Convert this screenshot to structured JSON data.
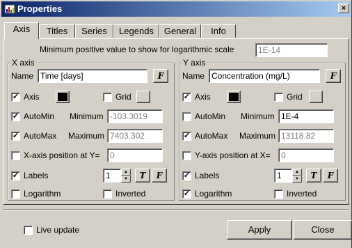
{
  "window": {
    "title": "Properties",
    "close_glyph": "×"
  },
  "tabs": [
    "Axis",
    "Titles",
    "Series",
    "Legends",
    "General",
    "Info"
  ],
  "min_positive": {
    "label": "Minimum positive value to show for  logarithmic scale",
    "value": "1E-14"
  },
  "x_axis": {
    "group_title": "X axis",
    "name_label": "Name",
    "name_value": "Time  [days]",
    "axis_label": "Axis",
    "axis_checked": true,
    "axis_color": "#000000",
    "grid_label": "Grid",
    "grid_checked": false,
    "grid_color": "#d4d0c8",
    "automin_label": "AutoMin",
    "automin_checked": true,
    "minimum_label": "Minimum",
    "minimum_value": "-103.3019",
    "automax_label": "AutoMax",
    "automax_checked": true,
    "maximum_label": "Maximum",
    "maximum_value": "7403.302",
    "pos_label": "X-axis position at Y=",
    "pos_checked": false,
    "pos_value": "0",
    "labels_label": "Labels",
    "labels_checked": true,
    "labels_value": "1",
    "log_label": "Logarithm",
    "log_checked": false,
    "inv_label": "Inverted",
    "inv_checked": false
  },
  "y_axis": {
    "group_title": "Y axis",
    "name_label": "Name",
    "name_value": "Concentration (mg/L)",
    "axis_label": "Axis",
    "axis_checked": true,
    "axis_color": "#000000",
    "grid_label": "Grid",
    "grid_checked": false,
    "grid_color": "#d4d0c8",
    "automin_label": "AutoMin",
    "automin_checked": false,
    "minimum_label": "Minimum",
    "minimum_value": "1E-4",
    "automax_label": "AutoMax",
    "automax_checked": true,
    "maximum_label": "Maximum",
    "maximum_value": "13118.82",
    "pos_label": "Y-axis position at X=",
    "pos_checked": false,
    "pos_value": "0",
    "labels_label": "Labels",
    "labels_checked": true,
    "labels_value": "1",
    "log_label": "Logarithm",
    "log_checked": true,
    "inv_label": "Inverted",
    "inv_checked": false
  },
  "buttons": {
    "f_label": "F",
    "t_label": "T"
  },
  "footer": {
    "live_update_label": "Live update",
    "live_update_checked": false,
    "apply_label": "Apply",
    "close_label": "Close"
  }
}
